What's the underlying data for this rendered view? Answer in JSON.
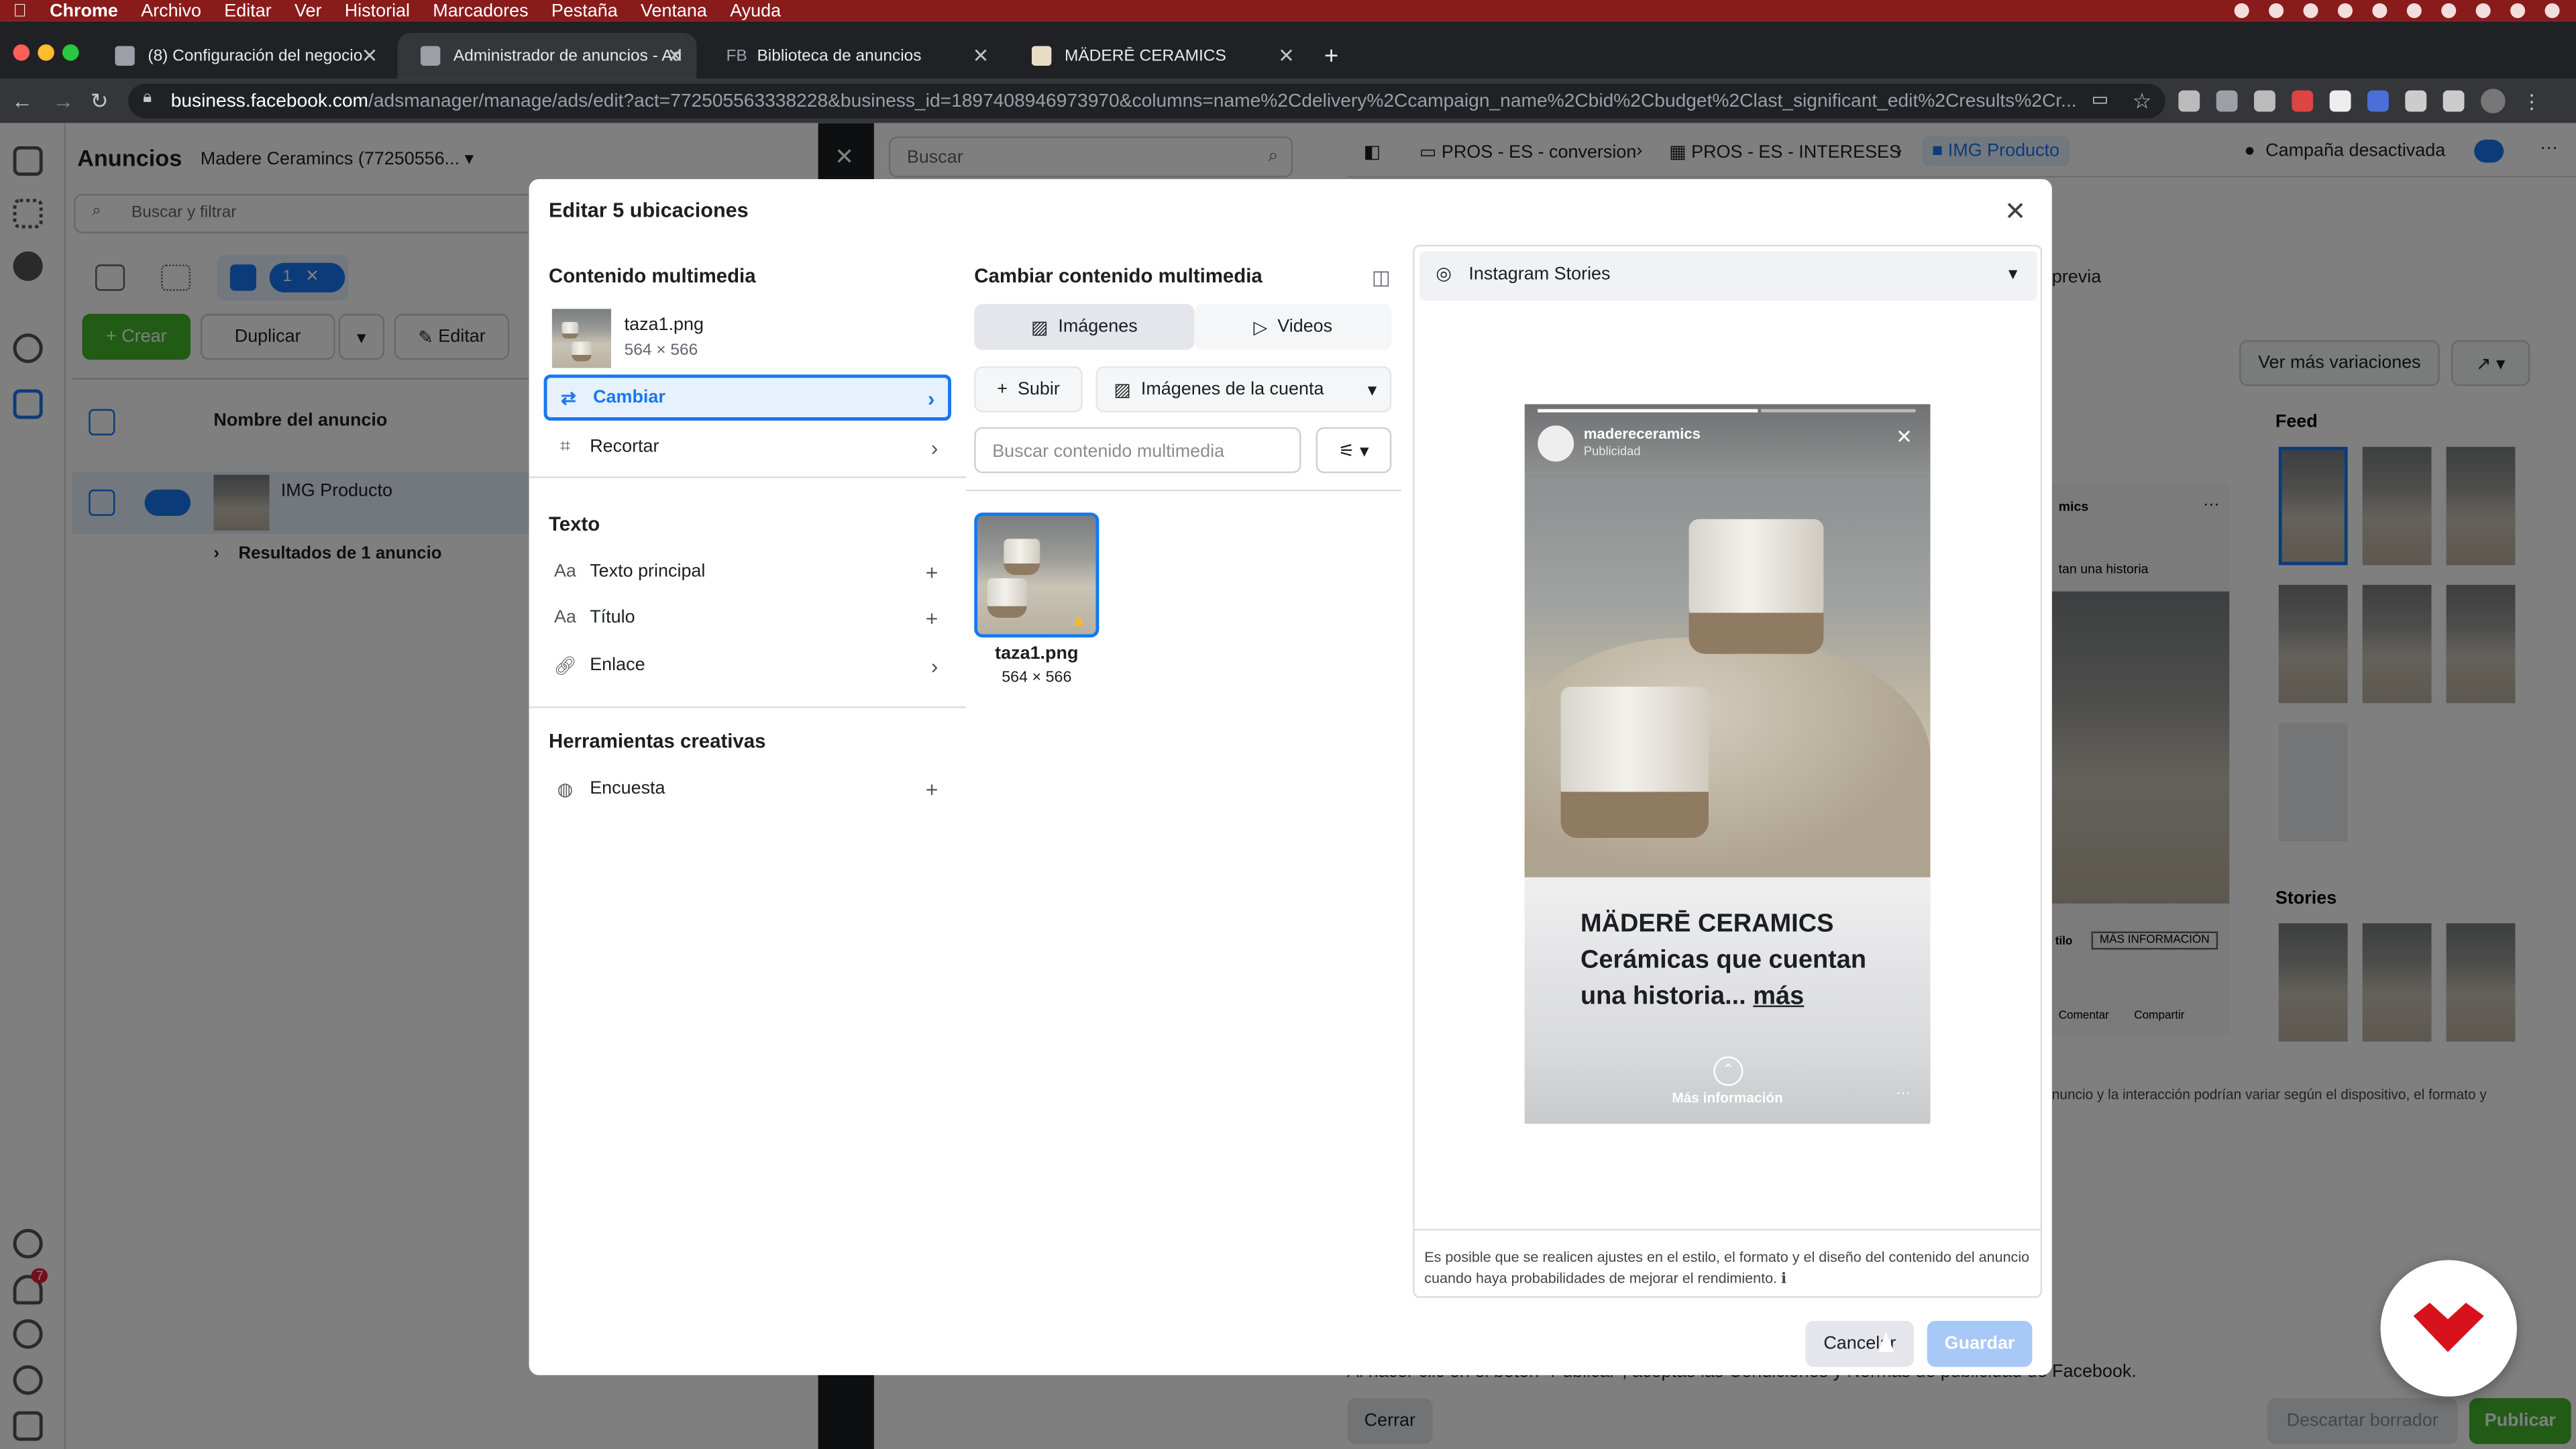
{
  "menubar": {
    "app": "Chrome",
    "items": [
      "Archivo",
      "Editar",
      "Ver",
      "Historial",
      "Marcadores",
      "Pestaña",
      "Ventana",
      "Ayuda"
    ]
  },
  "browser": {
    "tabs": [
      {
        "title": "(8) Configuración del negocio"
      },
      {
        "title": "Administrador de anuncios - Ad"
      },
      {
        "title": "Biblioteca de anuncios",
        "prefix": "FB"
      },
      {
        "title": "MÄDERĒ CERAMICS"
      }
    ],
    "url_host": "business.facebook.com",
    "url_path": "/adsmanager/manage/ads/edit?act=772505563338228&business_id=1897408946973970&columns=name%2Cdelivery%2Ccampaign_name%2Cbid%2Cbudget%2Clast_significant_edit%2Cresults%2Cr..."
  },
  "background": {
    "section_title": "Anuncios",
    "account": "Madere Ceramincs (77250556...",
    "search_placeholder": "Buscar y filtrar",
    "selection_count": "1",
    "toolbar": {
      "create": "Crear",
      "duplicate": "Duplicar",
      "edit": "Editar"
    },
    "table": {
      "column_name": "Nombre del anuncio",
      "ad_name": "IMG Producto",
      "results_row": "Resultados de 1 anuncio"
    },
    "editor_search_placeholder": "Buscar",
    "breadcrumb": [
      "PROS - ES - conversion",
      "PROS - ES - INTERESES",
      "IMG Producto"
    ],
    "campaign_status": "Campaña desactivada",
    "preview_label": "previa",
    "more_variations": "Ver más variaciones",
    "feed_label": "Feed",
    "stories_label": "Stories",
    "preview_snippet_name": "mics",
    "preview_snippet_text": "tan una historia",
    "preview_cta": "MÁS INFORMACIÓN",
    "preview_cta_side": "tilo",
    "preview_comment": "Comentar",
    "preview_share": "Compartir",
    "preview_note": "nuncio y la interacción podrían variar según el dispositivo, el formato y",
    "footer_text": "Al hacer clic en el botón \"Publicar\", aceptas las Condiciones y Normas de publicidad de Facebook.",
    "footer_close": "Cerrar",
    "footer_discard": "Descartar borrador",
    "footer_publish": "Publicar",
    "notification_count": "7"
  },
  "modal": {
    "title": "Editar 5 ubicaciones",
    "media_section": "Contenido multimedia",
    "media_file": {
      "name": "taza1.png",
      "dims": "564 × 566"
    },
    "change_label": "Cambiar",
    "crop_label": "Recortar",
    "text_section": "Texto",
    "primary_text": "Texto principal",
    "headline": "Título",
    "link": "Enlace",
    "creative_tools": "Herramientas creativas",
    "survey": "Encuesta",
    "change_media_title": "Cambiar contenido multimedia",
    "tab_images": "Imágenes",
    "tab_videos": "Videos",
    "upload": "Subir",
    "account_images": "Imágenes de la cuenta",
    "search_media_placeholder": "Buscar contenido multimedia",
    "grid_item": {
      "name": "taza1.png",
      "dims": "564 × 566"
    },
    "placement": "Instagram Stories",
    "story": {
      "username": "madereceramics",
      "sponsored": "Publicidad",
      "caption_brand": "MÄDERĒ CERAMICS",
      "caption_line1": "Cerámicas que cuentan",
      "caption_line2": "una historia...",
      "caption_more": "más",
      "cta": "Más información"
    },
    "disclaimer": "Es posible que se realicen ajustes en el estilo, el formato y el diseño del contenido del anuncio cuando haya probabilidades de mejorar el rendimiento.",
    "cancel": "Cancelar",
    "save": "Guardar"
  }
}
